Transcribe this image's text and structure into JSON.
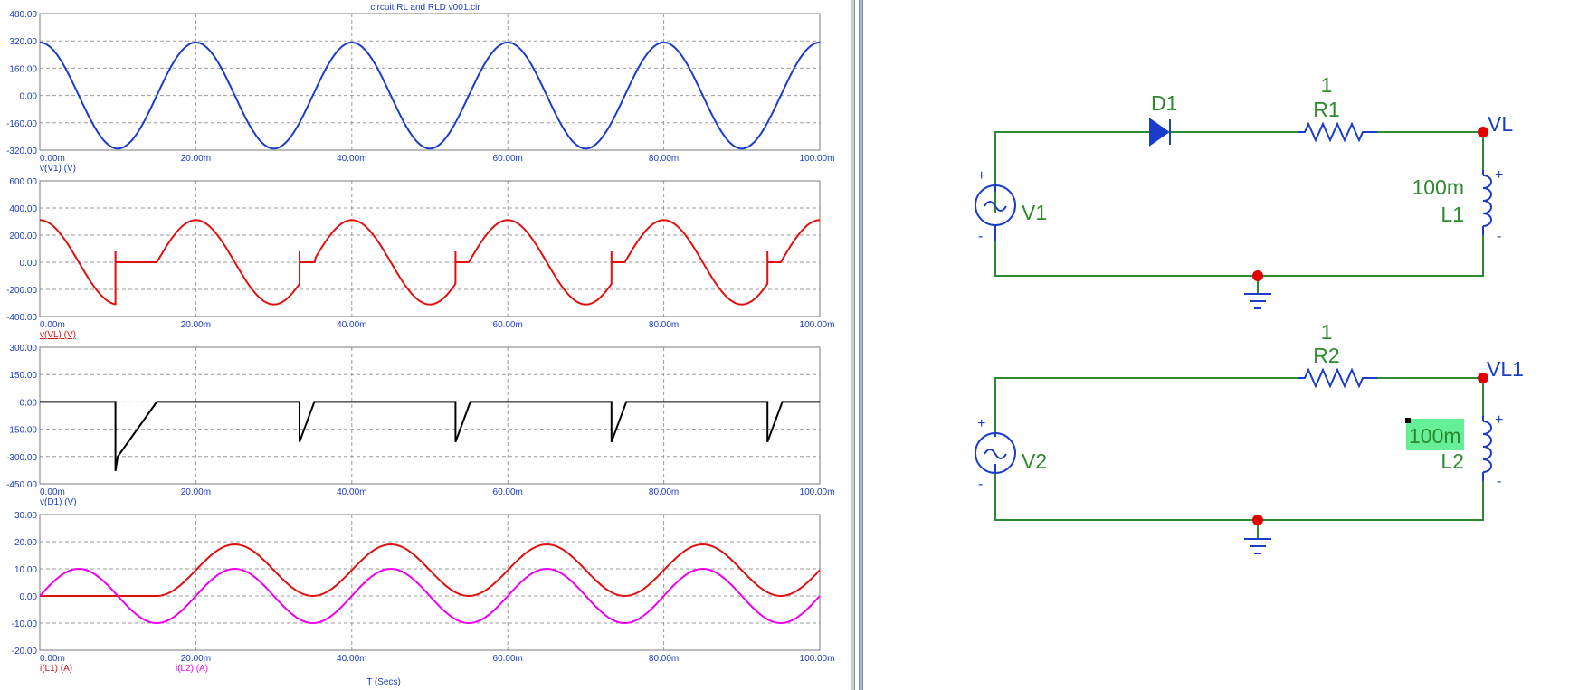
{
  "window": {
    "title": "circuit RL and RLD v001.cir"
  },
  "plots": [
    {
      "id": "v-v1",
      "yticks": [
        "480.00",
        "320.00",
        "160.00",
        "0.00",
        "-160.00",
        "-320.00"
      ],
      "xticks": [
        "0.00m",
        "20.00m",
        "40.00m",
        "60.00m",
        "80.00m",
        "100.00m"
      ],
      "labels": [
        {
          "text": "v(V1) (V)",
          "color": "#1a3cc8"
        }
      ]
    },
    {
      "id": "v-vl",
      "yticks": [
        "600.00",
        "400.00",
        "200.00",
        "0.00",
        "-200.00",
        "-400.00"
      ],
      "xticks": [
        "0.00m",
        "20.00m",
        "40.00m",
        "60.00m",
        "80.00m",
        "100.00m"
      ],
      "labels": [
        {
          "text": "v(VL) (V)",
          "color": "#e01010"
        }
      ]
    },
    {
      "id": "v-d1",
      "yticks": [
        "300.00",
        "150.00",
        "0.00",
        "-150.00",
        "-300.00",
        "-450.00"
      ],
      "xticks": [
        "0.00m",
        "20.00m",
        "40.00m",
        "60.00m",
        "80.00m",
        "100.00m"
      ],
      "labels": [
        {
          "text": "v(D1) (V)",
          "color": "#1a3cc8"
        }
      ]
    },
    {
      "id": "currents",
      "yticks": [
        "30.00",
        "20.00",
        "10.00",
        "0.00",
        "-10.00",
        "-20.00"
      ],
      "xticks": [
        "0.00m",
        "20.00m",
        "40.00m",
        "60.00m",
        "80.00m",
        "100.00m"
      ],
      "labels": [
        {
          "text": "i(L1) (A)",
          "color": "#e01010"
        },
        {
          "text": "i(L2) (A)",
          "color": "#ee00ee"
        }
      ],
      "xlabel": "T (Secs)"
    }
  ],
  "chart_data": [
    {
      "type": "line",
      "xlabel": "",
      "ylabel": "v(V1) (V)",
      "xlim": [
        0,
        100
      ],
      "ylim": [
        -320,
        480
      ],
      "grid": true,
      "series": [
        {
          "name": "v(V1) (V)",
          "color": "#1a3cc8",
          "function": "sine",
          "amplitude": 311,
          "period": 20,
          "phase_deg": 90,
          "x": [
            0,
            5,
            10,
            15,
            20,
            25,
            30,
            35,
            40,
            45,
            50,
            55,
            60,
            65,
            70,
            75,
            80,
            85,
            90,
            95,
            100
          ],
          "y": [
            311,
            0,
            -311,
            0,
            311,
            0,
            -311,
            0,
            311,
            0,
            -311,
            0,
            311,
            0,
            -311,
            0,
            311,
            0,
            -311,
            0,
            311
          ]
        }
      ]
    },
    {
      "type": "line",
      "xlabel": "",
      "ylabel": "v(VL) (V)",
      "xlim": [
        0,
        100
      ],
      "ylim": [
        -400,
        600
      ],
      "grid": true,
      "series": [
        {
          "name": "v(VL) (V)",
          "color": "#e01010",
          "x": [
            0,
            5,
            9.7,
            9.7,
            10,
            15,
            20,
            25,
            30,
            33.3,
            33.3,
            35.2,
            40,
            45,
            50,
            53.3,
            53.3,
            55.2,
            60,
            65,
            70,
            73.3,
            73.3,
            75.2,
            80,
            85,
            90,
            93.3,
            93.3,
            95.2,
            100
          ],
          "y": [
            311,
            0,
            -300,
            80,
            0,
            0,
            311,
            0,
            -311,
            -200,
            80,
            0,
            311,
            0,
            -311,
            -200,
            80,
            0,
            311,
            0,
            -311,
            -200,
            80,
            0,
            311,
            0,
            -311,
            -200,
            80,
            0,
            311
          ]
        }
      ]
    },
    {
      "type": "line",
      "xlabel": "",
      "ylabel": "v(D1) (V)",
      "xlim": [
        0,
        100
      ],
      "ylim": [
        -450,
        300
      ],
      "grid": true,
      "series": [
        {
          "name": "v(D1) (V)",
          "color": "#000000",
          "x": [
            0,
            9.7,
            9.7,
            10,
            15,
            33.3,
            33.3,
            35.2,
            53.3,
            53.3,
            55.2,
            73.3,
            73.3,
            75.2,
            93.3,
            93.3,
            95.2,
            100
          ],
          "y": [
            0,
            0,
            -380,
            -300,
            0,
            0,
            -220,
            0,
            0,
            -220,
            0,
            0,
            -220,
            0,
            0,
            -220,
            0,
            0
          ]
        }
      ]
    },
    {
      "type": "line",
      "xlabel": "T (Secs)",
      "ylabel": "",
      "xlim": [
        0,
        100
      ],
      "ylim": [
        -20,
        30
      ],
      "grid": true,
      "series": [
        {
          "name": "i(L1) (A)",
          "color": "#e01010",
          "x": [
            0,
            5,
            10,
            15,
            20,
            25,
            30,
            35,
            40,
            45,
            50,
            55,
            60,
            65,
            70,
            75,
            80,
            85,
            90,
            95,
            100
          ],
          "y": [
            0,
            0,
            0,
            0,
            10,
            19,
            10,
            0,
            10,
            19,
            10,
            0,
            10,
            19,
            10,
            0,
            10,
            19,
            10,
            0,
            10
          ]
        },
        {
          "name": "i(L2) (A)",
          "color": "#ee00ee",
          "x": [
            0,
            5,
            10,
            15,
            20,
            25,
            30,
            35,
            40,
            45,
            50,
            55,
            60,
            65,
            70,
            75,
            80,
            85,
            90,
            95,
            100
          ],
          "y": [
            0,
            10,
            0,
            -10,
            0,
            10,
            0,
            -10,
            0,
            10,
            0,
            -10,
            0,
            10,
            0,
            -10,
            0,
            10,
            0,
            -10,
            0
          ]
        }
      ]
    }
  ],
  "schematic": {
    "top": {
      "diode": "D1",
      "resistor_value": "1",
      "resistor": "R1",
      "node": "VL",
      "inductor_value": "100m",
      "inductor": "L1",
      "source": "V1"
    },
    "bottom": {
      "resistor_value": "1",
      "resistor": "R2",
      "node": "VL1",
      "inductor_value": "100m",
      "inductor": "L2",
      "source": "V2"
    },
    "plus": "+",
    "minus": "-",
    "colors": {
      "wire": "#2e8a2e",
      "component": "#1a3cc8",
      "node_dot": "#e00000",
      "highlight": "#66ee99"
    }
  }
}
